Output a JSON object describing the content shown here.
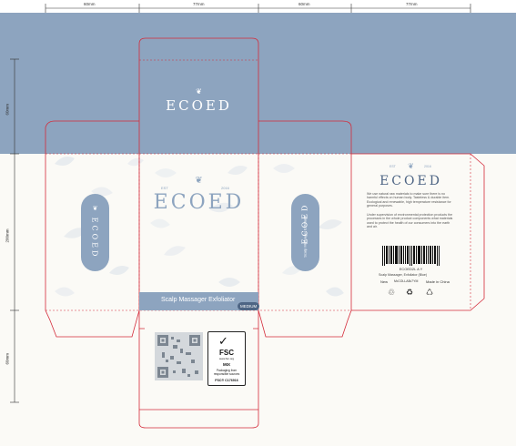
{
  "dimensions": {
    "top": [
      "60mm",
      "77mm",
      "60mm",
      "77mm"
    ],
    "left": [
      "60mm",
      "200mm",
      "60mm"
    ]
  },
  "brand": {
    "name": "ECOED",
    "est_left": "EST",
    "est_right": "2016"
  },
  "front_panel": {
    "product_name": "Scalp Massager Exfoliator",
    "size_badge": "MEDIUM"
  },
  "back_panel": {
    "paragraph_1": "We use natural raw materials to make sure there is no harmful effects on human body. Tasteless & durable item. Ecological and renewable, high temperature resistance for general purposes.",
    "paragraph_2": "Under supervision of environmental protection products the processes in the whole product components what materials used to protect the health of our consumers into the earth and air.",
    "barcode_number": "ECOED2L A Y",
    "product_desc": "Scalp Massager, Exfoliator (Blue)",
    "label_new": "New",
    "label_mid": "M•COLLAB•7YM",
    "made_in": "Made in China"
  },
  "fsc": {
    "title": "FSC",
    "website": "www.fsc.org",
    "mix_label": "MIX",
    "line1": "Packaging from",
    "line2": "responsible sources",
    "code": "FSC® C176916"
  },
  "colors": {
    "band": "#8da4bf",
    "cutline": "#d42b3a",
    "paper": "#fbfaf6",
    "accent": "#8da4bf"
  }
}
